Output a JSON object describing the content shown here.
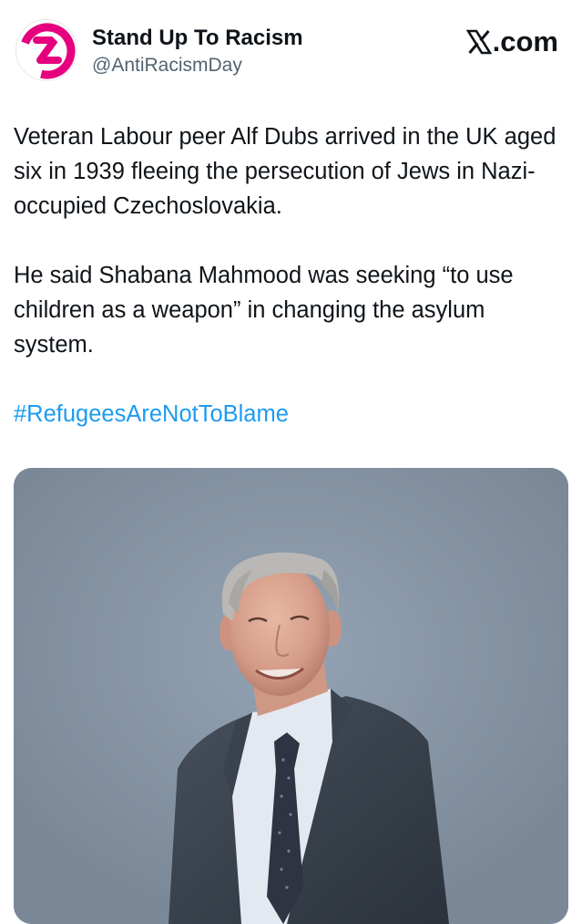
{
  "author": {
    "display_name": "Stand Up To Racism",
    "handle": "@AntiRacismDay",
    "avatar_icon": "stand-up-to-racism-logo",
    "brand_color": "#e5007e"
  },
  "source": {
    "label": ".com",
    "icon": "x-logo-icon"
  },
  "post": {
    "paragraph_1": "Veteran Labour peer Alf Dubs arrived in the UK aged six in 1939 fleeing the persecution of Jews in Nazi-occupied Czechoslovakia.",
    "paragraph_2": "He said Shabana Mahmood was seeking “to use children as a weapon” in changing the asylum system.",
    "hashtag": "#RefugeesAreNotToBlame",
    "hashtag_color": "#1d9bf0"
  },
  "media": {
    "type": "photo",
    "subject": "portrait-photo"
  }
}
